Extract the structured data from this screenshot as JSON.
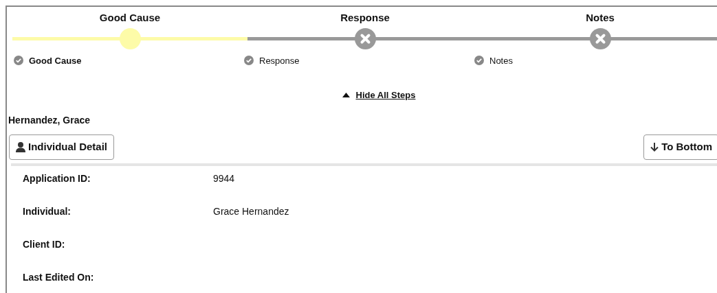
{
  "steps": [
    {
      "title": "Good Cause",
      "label": "Good Cause",
      "selected": true
    },
    {
      "title": "Response",
      "label": "Response",
      "selected": false
    },
    {
      "title": "Notes",
      "label": "Notes",
      "selected": false
    }
  ],
  "toggle": {
    "label": "Hide All Steps",
    "expanded": true
  },
  "person_name": "Hernandez, Grace",
  "buttons": {
    "left": "Individual Detail",
    "right": "To Bottom"
  },
  "fields": [
    {
      "label": "Application ID:",
      "value": "9944"
    },
    {
      "label": "Individual:",
      "value": "Grace Hernandez"
    },
    {
      "label": "Client ID:"
    },
    {
      "label": "Last Edited On:"
    }
  ]
}
